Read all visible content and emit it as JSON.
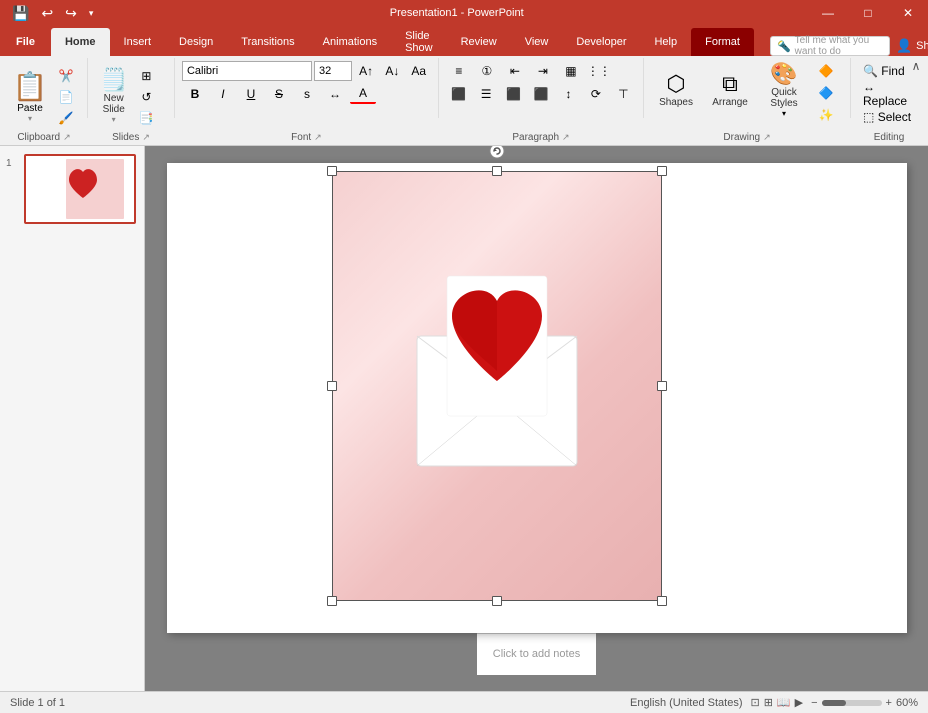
{
  "title": "Presentation1 - PowerPoint",
  "quickaccess": {
    "buttons": [
      "💾",
      "↩",
      "↪"
    ]
  },
  "tabs": [
    {
      "label": "File",
      "id": "file",
      "active": false
    },
    {
      "label": "Home",
      "id": "home",
      "active": true
    },
    {
      "label": "Insert",
      "id": "insert",
      "active": false
    },
    {
      "label": "Design",
      "id": "design",
      "active": false
    },
    {
      "label": "Transitions",
      "id": "transitions",
      "active": false
    },
    {
      "label": "Animations",
      "id": "animations",
      "active": false
    },
    {
      "label": "Slide Show",
      "id": "slideshow",
      "active": false
    },
    {
      "label": "Review",
      "id": "review",
      "active": false
    },
    {
      "label": "View",
      "id": "view",
      "active": false
    },
    {
      "label": "Developer",
      "id": "developer",
      "active": false
    },
    {
      "label": "Help",
      "id": "help",
      "active": false
    },
    {
      "label": "Format",
      "id": "format",
      "active": false,
      "context": true
    }
  ],
  "ribbon": {
    "groups": [
      {
        "id": "clipboard",
        "label": "Clipboard",
        "expand": true
      },
      {
        "id": "slides",
        "label": "Slides",
        "expand": true
      },
      {
        "id": "font",
        "label": "Font",
        "expand": true
      },
      {
        "id": "paragraph",
        "label": "Paragraph",
        "expand": true
      },
      {
        "id": "drawing",
        "label": "Drawing",
        "expand": true
      },
      {
        "id": "quickstyles",
        "label": "Quick Styles -",
        "expand": false
      },
      {
        "id": "editing",
        "label": "Editing",
        "expand": true
      }
    ],
    "font": {
      "name": "Calibri",
      "size": "32",
      "bold": "B",
      "italic": "I",
      "underline": "U",
      "strike": "S",
      "shadow": "A"
    }
  },
  "slide": {
    "number": 1,
    "notes_placeholder": "Click to add notes"
  },
  "tellme": {
    "placeholder": "Tell me what you want to do"
  },
  "window": {
    "minimize": "—",
    "maximize": "□",
    "close": "✕",
    "share": "Share"
  },
  "statusbar": {
    "slide_info": "Slide 1 of 1",
    "language": "English (United States)"
  }
}
